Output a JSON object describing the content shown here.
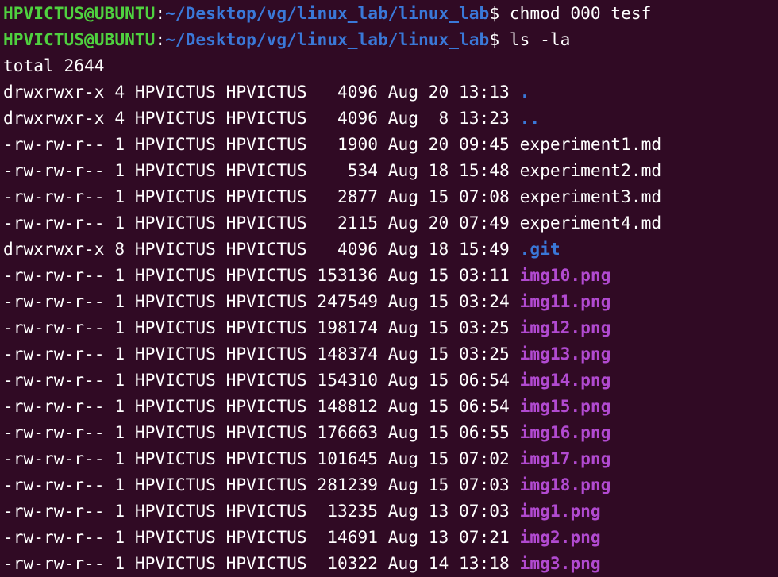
{
  "terminal": {
    "prompts": [
      {
        "user_host": "HPVICTUS@UBUNTU",
        "colon": ":",
        "path": "~/Desktop/vg/linux_lab/linux_lab",
        "symbol": "$",
        "command": " chmod 000 tesf"
      },
      {
        "user_host": "HPVICTUS@UBUNTU",
        "colon": ":",
        "path": "~/Desktop/vg/linux_lab/linux_lab",
        "symbol": "$",
        "command": " ls -la"
      }
    ],
    "total_line": "total 2644",
    "entries": [
      {
        "perms": "drwxrwxr-x",
        "links": "4",
        "owner": "HPVICTUS",
        "group": "HPVICTUS",
        "size": "4096",
        "month": "Aug",
        "day": "20",
        "time": "13:13",
        "name": ".",
        "type": "dir"
      },
      {
        "perms": "drwxrwxr-x",
        "links": "4",
        "owner": "HPVICTUS",
        "group": "HPVICTUS",
        "size": "4096",
        "month": "Aug",
        "day": "8",
        "time": "13:23",
        "name": "..",
        "type": "dir"
      },
      {
        "perms": "-rw-rw-r--",
        "links": "1",
        "owner": "HPVICTUS",
        "group": "HPVICTUS",
        "size": "1900",
        "month": "Aug",
        "day": "20",
        "time": "09:45",
        "name": "experiment1.md",
        "type": "file"
      },
      {
        "perms": "-rw-rw-r--",
        "links": "1",
        "owner": "HPVICTUS",
        "group": "HPVICTUS",
        "size": "534",
        "month": "Aug",
        "day": "18",
        "time": "15:48",
        "name": "experiment2.md",
        "type": "file"
      },
      {
        "perms": "-rw-rw-r--",
        "links": "1",
        "owner": "HPVICTUS",
        "group": "HPVICTUS",
        "size": "2877",
        "month": "Aug",
        "day": "15",
        "time": "07:08",
        "name": "experiment3.md",
        "type": "file"
      },
      {
        "perms": "-rw-rw-r--",
        "links": "1",
        "owner": "HPVICTUS",
        "group": "HPVICTUS",
        "size": "2115",
        "month": "Aug",
        "day": "20",
        "time": "07:49",
        "name": "experiment4.md",
        "type": "file"
      },
      {
        "perms": "drwxrwxr-x",
        "links": "8",
        "owner": "HPVICTUS",
        "group": "HPVICTUS",
        "size": "4096",
        "month": "Aug",
        "day": "18",
        "time": "15:49",
        "name": ".git",
        "type": "dir"
      },
      {
        "perms": "-rw-rw-r--",
        "links": "1",
        "owner": "HPVICTUS",
        "group": "HPVICTUS",
        "size": "153136",
        "month": "Aug",
        "day": "15",
        "time": "03:11",
        "name": "img10.png",
        "type": "img"
      },
      {
        "perms": "-rw-rw-r--",
        "links": "1",
        "owner": "HPVICTUS",
        "group": "HPVICTUS",
        "size": "247549",
        "month": "Aug",
        "day": "15",
        "time": "03:24",
        "name": "img11.png",
        "type": "img"
      },
      {
        "perms": "-rw-rw-r--",
        "links": "1",
        "owner": "HPVICTUS",
        "group": "HPVICTUS",
        "size": "198174",
        "month": "Aug",
        "day": "15",
        "time": "03:25",
        "name": "img12.png",
        "type": "img"
      },
      {
        "perms": "-rw-rw-r--",
        "links": "1",
        "owner": "HPVICTUS",
        "group": "HPVICTUS",
        "size": "148374",
        "month": "Aug",
        "day": "15",
        "time": "03:25",
        "name": "img13.png",
        "type": "img"
      },
      {
        "perms": "-rw-rw-r--",
        "links": "1",
        "owner": "HPVICTUS",
        "group": "HPVICTUS",
        "size": "154310",
        "month": "Aug",
        "day": "15",
        "time": "06:54",
        "name": "img14.png",
        "type": "img"
      },
      {
        "perms": "-rw-rw-r--",
        "links": "1",
        "owner": "HPVICTUS",
        "group": "HPVICTUS",
        "size": "148812",
        "month": "Aug",
        "day": "15",
        "time": "06:54",
        "name": "img15.png",
        "type": "img"
      },
      {
        "perms": "-rw-rw-r--",
        "links": "1",
        "owner": "HPVICTUS",
        "group": "HPVICTUS",
        "size": "176663",
        "month": "Aug",
        "day": "15",
        "time": "06:55",
        "name": "img16.png",
        "type": "img"
      },
      {
        "perms": "-rw-rw-r--",
        "links": "1",
        "owner": "HPVICTUS",
        "group": "HPVICTUS",
        "size": "101645",
        "month": "Aug",
        "day": "15",
        "time": "07:02",
        "name": "img17.png",
        "type": "img"
      },
      {
        "perms": "-rw-rw-r--",
        "links": "1",
        "owner": "HPVICTUS",
        "group": "HPVICTUS",
        "size": "281239",
        "month": "Aug",
        "day": "15",
        "time": "07:03",
        "name": "img18.png",
        "type": "img"
      },
      {
        "perms": "-rw-rw-r--",
        "links": "1",
        "owner": "HPVICTUS",
        "group": "HPVICTUS",
        "size": "13235",
        "month": "Aug",
        "day": "13",
        "time": "07:03",
        "name": "img1.png",
        "type": "img"
      },
      {
        "perms": "-rw-rw-r--",
        "links": "1",
        "owner": "HPVICTUS",
        "group": "HPVICTUS",
        "size": "14691",
        "month": "Aug",
        "day": "13",
        "time": "07:21",
        "name": "img2.png",
        "type": "img"
      },
      {
        "perms": "-rw-rw-r--",
        "links": "1",
        "owner": "HPVICTUS",
        "group": "HPVICTUS",
        "size": "10322",
        "month": "Aug",
        "day": "14",
        "time": "13:18",
        "name": "img3.png",
        "type": "img"
      }
    ]
  },
  "colors": {
    "background": "#300a24",
    "prompt_user": "#4fd13f",
    "prompt_path": "#3a78d8",
    "directory": "#3a78d8",
    "image_file": "#b14ad0",
    "text": "#ffffff"
  }
}
